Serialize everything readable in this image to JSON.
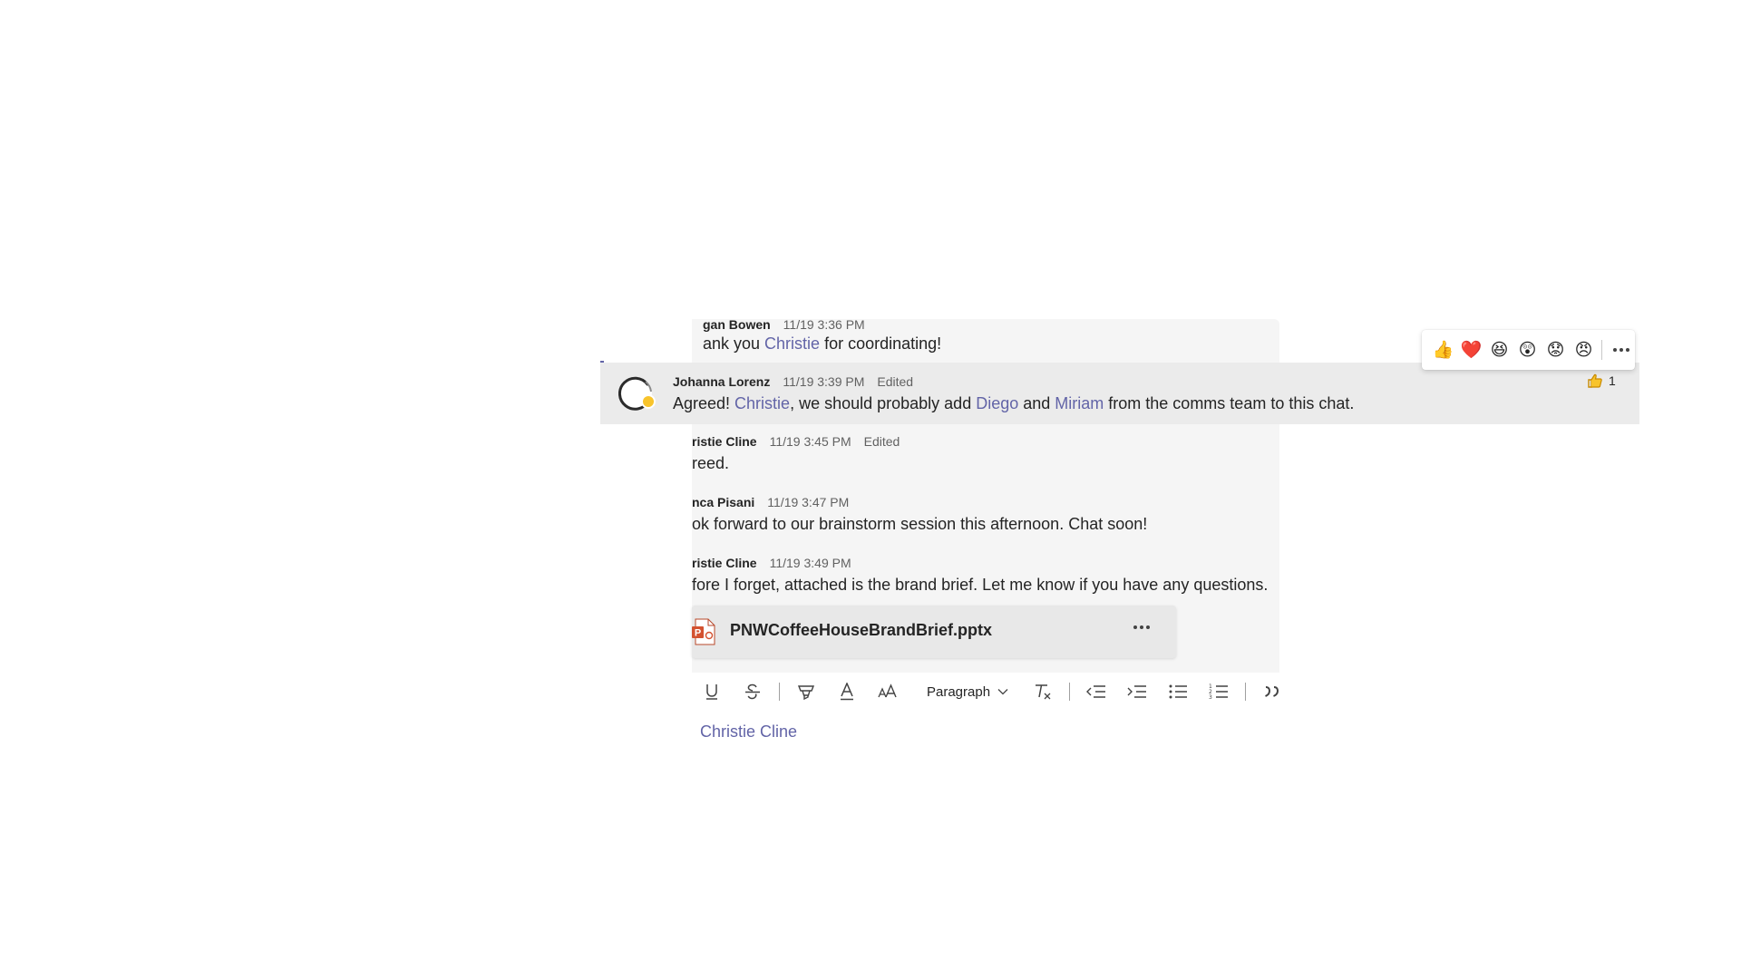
{
  "messages": [
    {
      "author": "gan Bowen",
      "time": "11/19 3:36 PM",
      "edited": "",
      "text_parts": [
        "ank you ",
        "Christie",
        " for coordinating!"
      ]
    },
    {
      "author": "Johanna Lorenz",
      "time": "11/19 3:39 PM",
      "edited": "Edited",
      "text_parts": [
        "Agreed! ",
        "Christie",
        ", we should probably add ",
        "Diego",
        " and ",
        "Miriam",
        " from the comms team to this chat."
      ],
      "reaction": {
        "icon": "thumbs-up",
        "count": "1"
      }
    },
    {
      "author": "ristie Cline",
      "time": "11/19 3:45 PM",
      "edited": "Edited",
      "text": "reed."
    },
    {
      "author": "nca Pisani",
      "time": "11/19 3:47 PM",
      "edited": "",
      "text": "ok forward to our brainstorm session this afternoon. Chat soon!"
    },
    {
      "author": "ristie Cline",
      "time": "11/19 3:49 PM",
      "edited": "",
      "text": "fore I forget, attached is the brand brief. Let me know if you have any questions."
    }
  ],
  "attachment": {
    "file_name": "PNWCoffeeHouseBrandBrief.pptx",
    "icon": "powerpoint-file"
  },
  "reaction_bar": {
    "emojis": [
      "👍",
      "❤️",
      "😆",
      "😲",
      "😟",
      "😠"
    ],
    "icons": [
      "like",
      "heart",
      "laugh",
      "surprised",
      "sad",
      "angry"
    ]
  },
  "toolbar": {
    "paragraph_label": "Paragraph"
  },
  "compose": {
    "mention": "Christie Cline"
  },
  "colors": {
    "accent": "#6264a7",
    "presence_away": "#f8c42c",
    "chat_bg": "#f5f5f5",
    "hover_row": "#ebebeb"
  }
}
